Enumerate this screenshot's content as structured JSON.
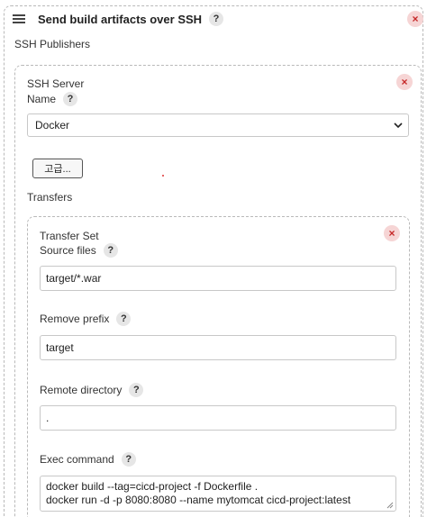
{
  "section": {
    "title": "Send build artifacts over SSH",
    "help": "?",
    "close": "×"
  },
  "ssh_publishers_label": "SSH Publishers",
  "ssh_server": {
    "heading": "SSH Server",
    "name_label": "Name",
    "help": "?",
    "close": "×",
    "name_value": "Docker",
    "advanced_button": "고급..."
  },
  "transfers_label": "Transfers",
  "transfer_set": {
    "heading": "Transfer Set",
    "close": "×",
    "source_files_label": "Source files",
    "source_files_value": "target/*.war",
    "remove_prefix_label": "Remove prefix",
    "remove_prefix_value": "target",
    "remote_directory_label": "Remote directory",
    "remote_directory_value": ".",
    "exec_command_label": "Exec command",
    "exec_command_lines": [
      "docker build --tag=cicd-project -f Dockerfile .",
      "docker run -d -p 8080:8080 --name mytomcat cicd-project:latest"
    ],
    "help": "?"
  }
}
